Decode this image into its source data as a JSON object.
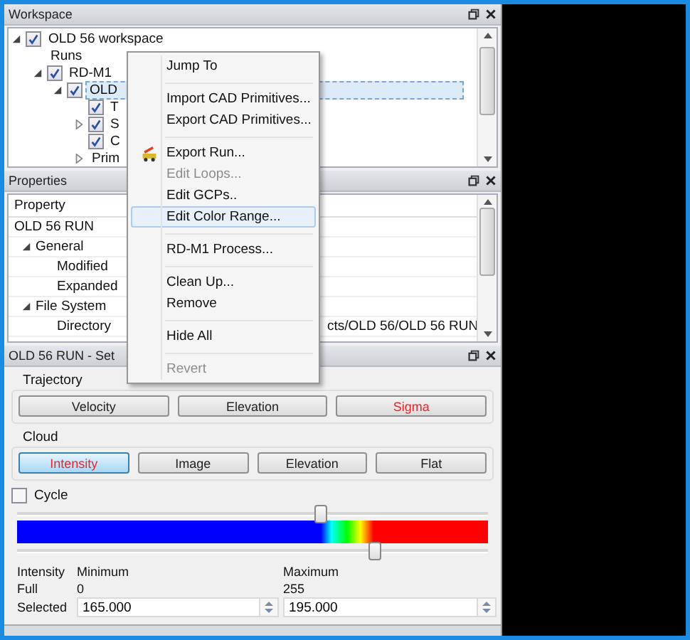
{
  "workspace": {
    "title": "Workspace",
    "tree": [
      {
        "label": "OLD 56 workspace",
        "checked": true,
        "expanded": true,
        "selected": false,
        "children": [
          {
            "label": "Runs",
            "selected": false
          },
          {
            "label": "RD-M1",
            "checked": true,
            "expanded": true,
            "selected": false,
            "children": [
              {
                "label": "OLD",
                "checked": true,
                "expanded": true,
                "selected": true,
                "children": [
                  {
                    "label": "T",
                    "checked": true,
                    "selected": false
                  },
                  {
                    "label": "S",
                    "checked": true,
                    "expanded": false,
                    "selected": false
                  },
                  {
                    "label": "C",
                    "checked": true,
                    "selected": false
                  },
                  {
                    "label": "Prim",
                    "expanded": false,
                    "selected": false
                  }
                ]
              }
            ]
          }
        ]
      }
    ]
  },
  "properties": {
    "title": "Properties",
    "column": "Property",
    "rows": [
      {
        "label": "OLD 56 RUN",
        "children": [
          {
            "label": "General",
            "expanded": true,
            "children": [
              {
                "label": "Modified"
              },
              {
                "label": "Expanded"
              }
            ]
          },
          {
            "label": "File System",
            "expanded": true,
            "children": [
              {
                "label": "Directory",
                "value": "cts/OLD 56/OLD 56 RUN"
              }
            ]
          }
        ]
      }
    ]
  },
  "color_panel": {
    "title": "OLD 56 RUN - Set",
    "groups": [
      {
        "title": "Trajectory",
        "buttons": [
          {
            "label": "Velocity",
            "selected": false,
            "marked": false
          },
          {
            "label": "Elevation",
            "selected": false,
            "marked": false
          },
          {
            "label": "Sigma",
            "selected": false,
            "marked": true
          }
        ]
      },
      {
        "title": "Cloud",
        "buttons": [
          {
            "label": "Intensity",
            "selected": true,
            "marked": true
          },
          {
            "label": "Image",
            "selected": false,
            "marked": false
          },
          {
            "label": "Elevation",
            "selected": false,
            "marked": false
          },
          {
            "label": "Flat",
            "selected": false,
            "marked": false
          }
        ]
      }
    ],
    "cycle": {
      "label": "Cycle",
      "checked": false
    },
    "min_slider": {
      "level": 0.645
    },
    "max_slider": {
      "level": 0.757
    },
    "range": {
      "heading_1": "Intensity",
      "heading_2": "Minimum",
      "heading_3": "Maximum",
      "full_label": "Full",
      "full_min": "0",
      "full_max": "255",
      "selected_label": "Selected",
      "selected_min": "165.000",
      "selected_max": "195.000"
    }
  },
  "context_menu": [
    {
      "kind": "item",
      "label": "Jump To",
      "disabled": false,
      "selected": false
    },
    {
      "kind": "separator"
    },
    {
      "kind": "item",
      "label": "Import CAD Primitives...",
      "disabled": false,
      "selected": false
    },
    {
      "kind": "item",
      "label": "Export CAD Primitives...",
      "disabled": false,
      "selected": false
    },
    {
      "kind": "separator"
    },
    {
      "kind": "item",
      "label": "Export Run...",
      "disabled": false,
      "selected": false,
      "icon": true
    },
    {
      "kind": "item",
      "label": "Edit Loops...",
      "disabled": true,
      "selected": false
    },
    {
      "kind": "item",
      "label": "Edit GCPs..",
      "disabled": false,
      "selected": false
    },
    {
      "kind": "item",
      "label": "Edit Color Range...",
      "disabled": false,
      "selected": true
    },
    {
      "kind": "separator"
    },
    {
      "kind": "item",
      "label": "RD-M1 Process...",
      "disabled": false,
      "selected": false
    },
    {
      "kind": "separator"
    },
    {
      "kind": "item",
      "label": "Clean Up...",
      "disabled": false,
      "selected": false
    },
    {
      "kind": "item",
      "label": "Remove",
      "disabled": false,
      "selected": false
    },
    {
      "kind": "separator"
    },
    {
      "kind": "item",
      "label": "Hide All",
      "disabled": false,
      "selected": false
    },
    {
      "kind": "separator"
    },
    {
      "kind": "item",
      "label": "Revert",
      "disabled": true,
      "selected": false
    }
  ]
}
